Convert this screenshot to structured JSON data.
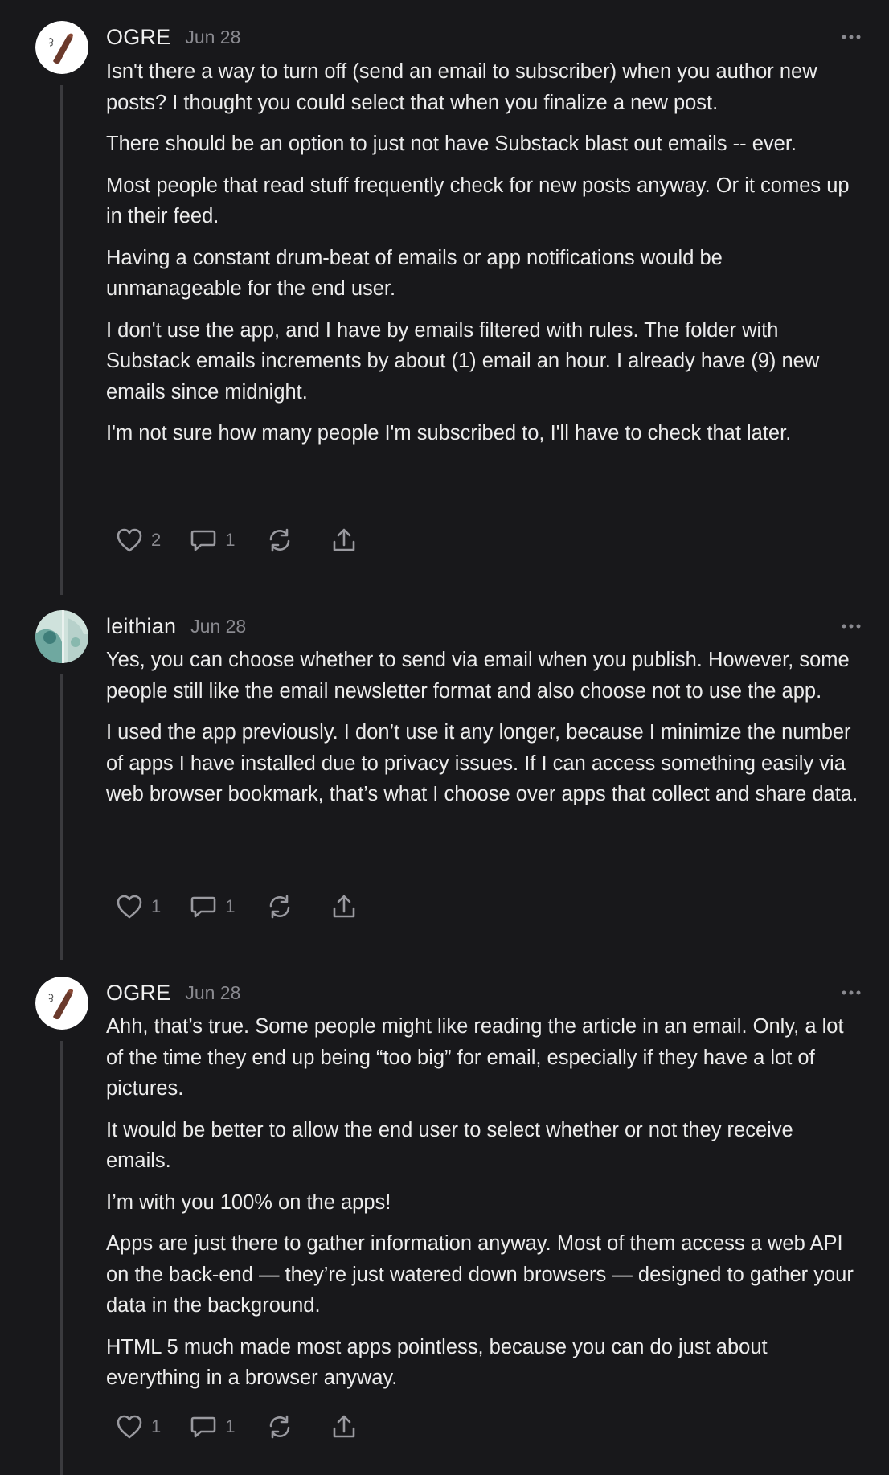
{
  "comments": [
    {
      "author": "OGRE",
      "date": "Jun 28",
      "avatar_icon": "ogre-avatar",
      "paragraphs": [
        "Isn't there a way to turn off (send an email to subscriber) when you author new posts? I thought you could select that when you finalize a new post.",
        "There should be an option to just not have Substack blast out emails -- ever.",
        "Most people that read stuff frequently check for new posts anyway. Or it comes up in their feed.",
        "Having a constant drum-beat of emails or app notifications would be unmanageable for the end user.",
        "I don't use the app, and I have by emails filtered with rules. The folder with Substack emails increments by about (1) email an hour. I already have (9) new emails since midnight.",
        "I'm not sure how many people I'm subscribed to, I'll have to check that later."
      ],
      "likes": "2",
      "replies": "1"
    },
    {
      "author": "leithian",
      "date": "Jun 28",
      "avatar_icon": "leithian-avatar",
      "paragraphs": [
        "Yes, you can choose whether to send via email when you publish. However, some people still like the email newsletter format and also choose not to use the app.",
        "I used the app previously. I don’t use it any longer, because I minimize the number of apps I have installed due to privacy issues. If I can access something easily via web browser bookmark, that’s what I choose over apps that collect and share data."
      ],
      "likes": "1",
      "replies": "1"
    },
    {
      "author": "OGRE",
      "date": "Jun 28",
      "avatar_icon": "ogre-avatar",
      "paragraphs": [
        "Ahh, that’s true. Some people might like reading the article in an email. Only, a lot of the time they end up being “too big” for email, especially if they have a lot of pictures.",
        "It would be better to allow the end user to select whether or not they receive emails.",
        "I’m with you 100% on the apps!",
        "Apps are just there to gather information anyway. Most of them access a web API on the back-end — they’re just watered down browsers — designed to gather your data in the background.",
        "HTML 5 much made most apps pointless, because you can do just about everything in a browser anyway."
      ],
      "likes": "1",
      "replies": "1"
    }
  ],
  "icons": {
    "like": "heart-icon",
    "reply": "comment-bubble-icon",
    "restack": "restack-icon",
    "share": "share-icon",
    "more": "more-options-icon"
  },
  "colors": {
    "background": "#18181b",
    "text": "#ececec",
    "muted": "#8a8a90",
    "thread_line": "#3a3a3e"
  }
}
